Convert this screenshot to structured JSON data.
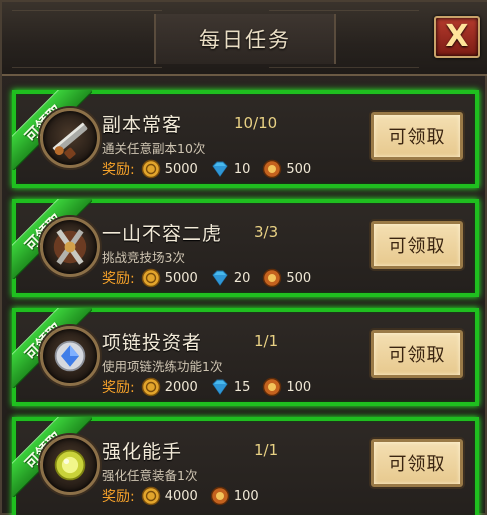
{
  "header": {
    "title": "每日任务",
    "close_label": "X"
  },
  "colors": {
    "card_border": "#1fbf1f",
    "reward_label": "#f6a22a",
    "progress": "#e8d184",
    "button_bg": "#f4dfb2"
  },
  "tasks": [
    {
      "ribbon": "可领取",
      "icon": "sword-icon",
      "name": "副本常客",
      "progress": "10/10",
      "desc": "通关任意副本10次",
      "reward_label": "奖励:",
      "coins": "5000",
      "gems": "10",
      "exp": "500",
      "button": "可领取"
    },
    {
      "ribbon": "可领取",
      "icon": "crossed-swords-icon",
      "name": "一山不容二虎",
      "progress": "3/3",
      "desc": "挑战竞技场3次",
      "reward_label": "奖励:",
      "coins": "5000",
      "gems": "20",
      "exp": "500",
      "button": "可领取"
    },
    {
      "ribbon": "可领取",
      "icon": "necklace-gem-icon",
      "name": "项链投资者",
      "progress": "1/1",
      "desc": "使用项链洗练功能1次",
      "reward_label": "奖励:",
      "coins": "2000",
      "gems": "15",
      "exp": "100",
      "button": "可领取"
    },
    {
      "ribbon": "可领取",
      "icon": "yellow-gem-icon",
      "name": "强化能手",
      "progress": "1/1",
      "desc": "强化任意装备1次",
      "reward_label": "奖励:",
      "coins": "4000",
      "gems": "",
      "exp": "100",
      "button": "可领取"
    }
  ]
}
